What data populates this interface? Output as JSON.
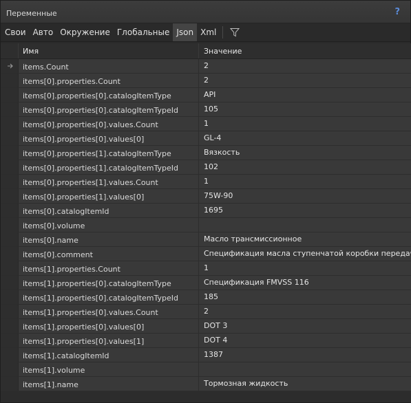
{
  "window": {
    "title": "Переменные",
    "help_icon": "?"
  },
  "tabs": [
    {
      "label": "Свои",
      "active": false
    },
    {
      "label": "Авто",
      "active": false
    },
    {
      "label": "Окружение",
      "active": false
    },
    {
      "label": "Глобальные",
      "active": false
    },
    {
      "label": "Json",
      "active": true
    },
    {
      "label": "Xml",
      "active": false
    }
  ],
  "filter_icon": "funnel-icon",
  "grid": {
    "columns": {
      "name": "Имя",
      "value": "Значение"
    },
    "current_row_icon": "arrow-right-icon",
    "rows": [
      {
        "name": "items.Count",
        "value": "2"
      },
      {
        "name": "items[0].properties.Count",
        "value": "2"
      },
      {
        "name": "items[0].properties[0].catalogItemType",
        "value": "API"
      },
      {
        "name": "items[0].properties[0].catalogItemTypeId",
        "value": "105"
      },
      {
        "name": "items[0].properties[0].values.Count",
        "value": "1"
      },
      {
        "name": "items[0].properties[0].values[0]",
        "value": "GL-4"
      },
      {
        "name": "items[0].properties[1].catalogItemType",
        "value": "Вязкость"
      },
      {
        "name": "items[0].properties[1].catalogItemTypeId",
        "value": "102"
      },
      {
        "name": "items[0].properties[1].values.Count",
        "value": "1"
      },
      {
        "name": "items[0].properties[1].values[0]",
        "value": "75W-90"
      },
      {
        "name": "items[0].catalogItemId",
        "value": "1695"
      },
      {
        "name": "items[0].volume",
        "value": ""
      },
      {
        "name": "items[0].name",
        "value": "Масло трансмиссионное"
      },
      {
        "name": "items[0].comment",
        "value": "Спецификация масла ступенчатой коробки передач"
      },
      {
        "name": "items[1].properties.Count",
        "value": "1"
      },
      {
        "name": "items[1].properties[0].catalogItemType",
        "value": "Спецификация FMVSS 116"
      },
      {
        "name": "items[1].properties[0].catalogItemTypeId",
        "value": "185"
      },
      {
        "name": "items[1].properties[0].values.Count",
        "value": "2"
      },
      {
        "name": "items[1].properties[0].values[0]",
        "value": "DOT 3"
      },
      {
        "name": "items[1].properties[0].values[1]",
        "value": "DOT 4"
      },
      {
        "name": "items[1].catalogItemId",
        "value": "1387"
      },
      {
        "name": "items[1].volume",
        "value": ""
      },
      {
        "name": "items[1].name",
        "value": "Тормозная жидкость"
      }
    ]
  },
  "colors": {
    "accent_help": "#5b8bd8",
    "active_tab": "#444444",
    "row_bg": "#393939"
  }
}
